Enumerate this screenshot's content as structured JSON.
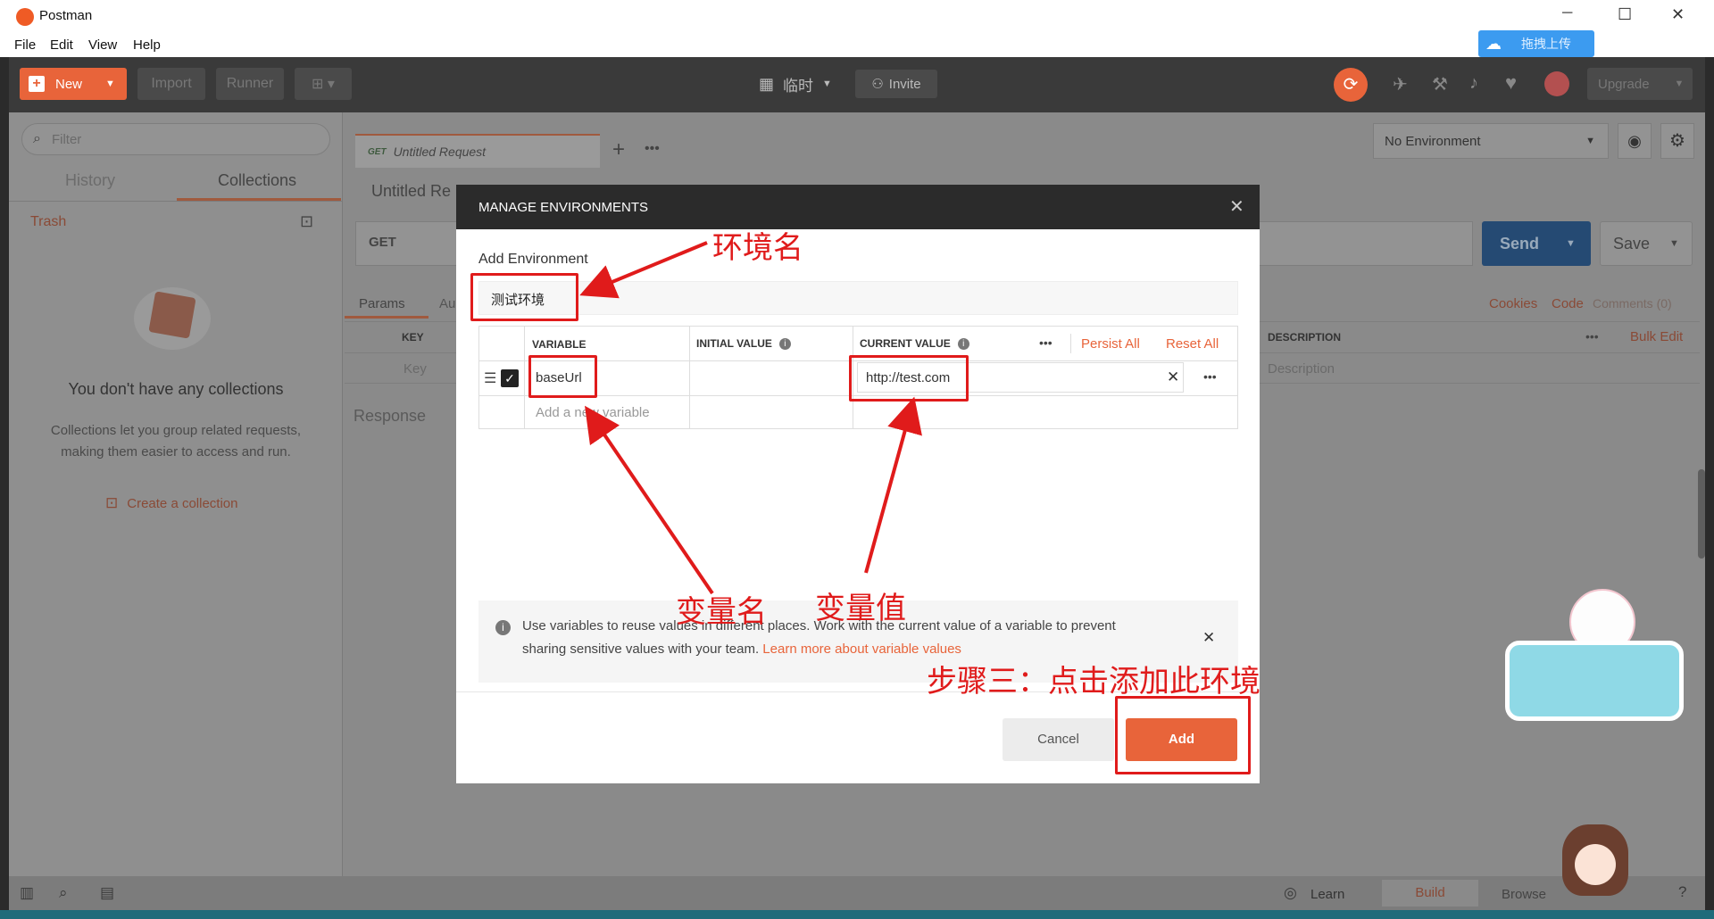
{
  "window": {
    "title": "Postman",
    "minimize": "─",
    "maximize": "☐",
    "close": "✕"
  },
  "menu": [
    "File",
    "Edit",
    "View",
    "Help"
  ],
  "upload_widget": {
    "label": "拖拽上传"
  },
  "toolbar": {
    "new_label": "New",
    "import_label": "Import",
    "runner_label": "Runner",
    "workspace_label": "临时",
    "invite_label": "Invite",
    "upgrade_label": "Upgrade"
  },
  "sidebar": {
    "filter_placeholder": "Filter",
    "tabs": [
      "History",
      "Collections"
    ],
    "trash_label": "Trash",
    "empty_title": "You don't have any collections",
    "empty_desc_1": "Collections let you group related requests,",
    "empty_desc_2": "making them easier to access and run.",
    "create_label": "Create a collection"
  },
  "request": {
    "tab_method": "GET",
    "tab_name": "Untitled Request",
    "title": "Untitled Re",
    "method": "GET",
    "send_label": "Send",
    "save_label": "Save",
    "params_tab": "Params",
    "auth_tab": "Au",
    "cookies": "Cookies",
    "code": "Code",
    "comments": "Comments (0)",
    "key_header": "KEY",
    "key_placeholder": "Key",
    "desc_header": "DESCRIPTION",
    "desc_placeholder": "Description",
    "bulk_edit": "Bulk Edit",
    "response_label": "Response"
  },
  "environment": {
    "selected": "No Environment"
  },
  "modal": {
    "title": "MANAGE ENVIRONMENTS",
    "close": "✕",
    "add_env_label": "Add Environment",
    "env_name": "测试环境",
    "col_variable": "VARIABLE",
    "col_initial": "INITIAL VALUE",
    "col_current": "CURRENT VALUE",
    "persist_all": "Persist All",
    "reset_all": "Reset All",
    "row": {
      "variable": "baseUrl",
      "initial": "",
      "current": "http://test.com",
      "checked": true
    },
    "new_variable_placeholder": "Add a new variable",
    "info_text_1": "Use variables to reuse values in different places. Work with the current value of a variable to prevent",
    "info_text_2": "sharing sensitive values with your team.",
    "info_link": "Learn more about variable values",
    "cancel_label": "Cancel",
    "add_label": "Add"
  },
  "annotations": {
    "env_name": "环境名",
    "var_name": "变量名",
    "var_value": "变量值",
    "step3": "步骤三：点击添加此环境"
  },
  "status": {
    "learn": "Learn",
    "build": "Build",
    "browse": "Browse"
  },
  "colors": {
    "accent": "#e8643a",
    "send": "#2a6fb0",
    "annotation": "#e01b1b",
    "header_dark": "#2b2b2b"
  }
}
